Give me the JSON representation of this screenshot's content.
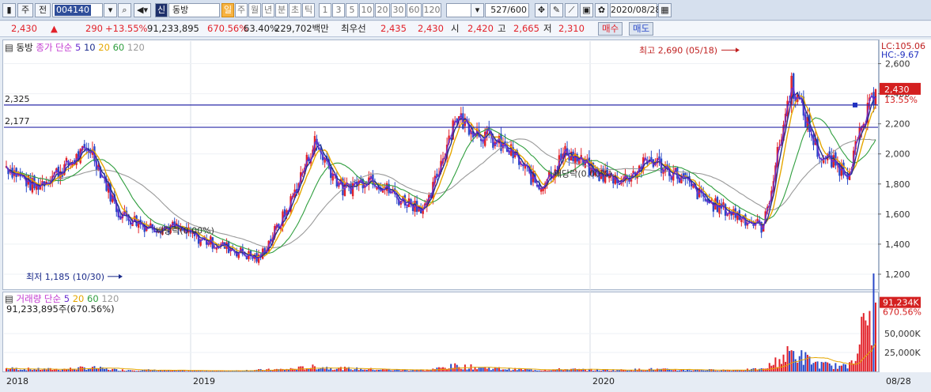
{
  "toolbar": {
    "market": "주",
    "view": "전",
    "code": "004140",
    "badge": "신",
    "name": "동방",
    "periods": [
      "일",
      "주",
      "월",
      "년",
      "분",
      "초",
      "틱"
    ],
    "intervals": [
      "1",
      "3",
      "5",
      "10",
      "20",
      "30",
      "60",
      "120"
    ],
    "count": "527",
    "count_total": "/600",
    "date": "2020/08/28"
  },
  "quote": {
    "price": "2,430",
    "arrow": "▲",
    "change": "290",
    "change_pct": "+13.55%",
    "volume": "91,233,895",
    "vol_pct": "670.56%",
    "ratio": "63.40%",
    "amount": "229,702백만",
    "best_label": "최우선",
    "ask": "2,435",
    "bid": "2,430",
    "open_label": "시",
    "open": "2,420",
    "high_label": "고",
    "high": "2,665",
    "low_label": "저",
    "low": "2,310",
    "buy_label": "매수",
    "sell_label": "매도"
  },
  "price_legend": {
    "name": "동방",
    "type": "종가 단순",
    "periods": [
      "5",
      "10",
      "20",
      "60",
      "120"
    ]
  },
  "volume_legend": {
    "type": "거래량 단순",
    "periods": [
      "5",
      "20",
      "60",
      "120"
    ],
    "value": "91,233,895주(670.56%)"
  },
  "corner": {
    "lc": "LC:105.06",
    "hc": "HC:-9.67"
  },
  "hlines": [
    {
      "label": "2,325",
      "value": 2325
    },
    {
      "label": "2,177",
      "value": 2177
    }
  ],
  "annotations": {
    "high": "최고 2,690 (05/18)",
    "low": "최저 1,185 (10/30)",
    "div1": "배당락(0.00%)",
    "div2": "배당락(0.00%)"
  },
  "price_tags": {
    "price": "2,430",
    "pct": "13.55%"
  },
  "volume_tags": {
    "vol": "91,234K",
    "pct": "670.56%"
  },
  "x_labels": [
    "2018",
    "2019",
    "2020",
    "08/28"
  ],
  "colors": {
    "up": "#e2222a",
    "down": "#2a49c9",
    "ma5": "#6a2fd0",
    "ma10": "#1f2f8f",
    "ma20": "#e5a700",
    "ma60": "#2f9e3e",
    "ma120": "#9a9a9a",
    "hline": "#2a2aa8"
  },
  "chart_data": {
    "type": "candlestick",
    "x_range": [
      "2018",
      "2020/08/28"
    ],
    "y_ticks": [
      1200,
      1400,
      1600,
      1800,
      2000,
      2200,
      2400,
      2600
    ],
    "y_range": [
      1100,
      2750
    ],
    "volume_ticks": [
      "25,000K",
      "50,000K"
    ],
    "volume_ticks_values": [
      25000000,
      50000000
    ],
    "x": [
      "2018-01",
      "2018-02",
      "2018-03",
      "2018-04",
      "2018-05",
      "2018-06",
      "2018-07",
      "2018-08",
      "2018-09",
      "2018-10",
      "2018-11",
      "2018-12",
      "2019-01",
      "2019-02",
      "2019-03",
      "2019-04",
      "2019-05",
      "2019-06",
      "2019-07",
      "2019-08",
      "2019-09",
      "2019-10",
      "2019-11",
      "2019-12",
      "2020-01",
      "2020-02",
      "2020-03",
      "2020-04",
      "2020-05",
      "2020-06",
      "2020-07",
      "2020-08"
    ],
    "close": [
      1920,
      1780,
      1900,
      2040,
      1610,
      1520,
      1510,
      1430,
      1370,
      1300,
      1620,
      2080,
      1760,
      1850,
      1700,
      1640,
      2250,
      2130,
      2010,
      1780,
      2020,
      1870,
      1830,
      1960,
      1850,
      1680,
      1600,
      1510,
      2470,
      1990,
      1880,
      2430
    ],
    "volume_m": [
      4,
      3,
      3,
      5,
      2,
      2,
      1,
      1,
      1,
      2,
      3,
      6,
      4,
      3,
      2,
      2,
      7,
      5,
      3,
      2,
      3,
      2,
      2,
      3,
      2,
      2,
      2,
      3,
      25,
      9,
      6,
      91
    ]
  }
}
